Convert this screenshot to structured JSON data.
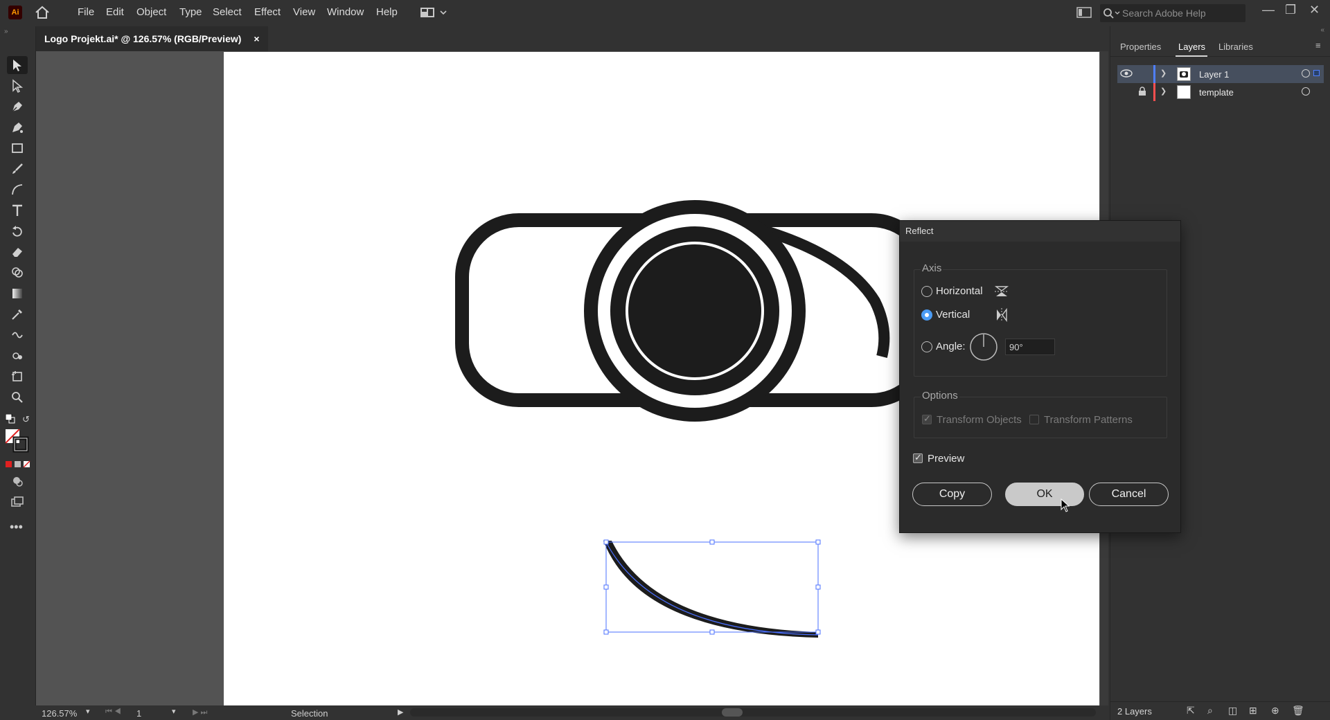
{
  "app": {
    "logo": "Ai",
    "name": "Adobe Illustrator"
  },
  "menu": [
    "File",
    "Edit",
    "Object",
    "Type",
    "Select",
    "Effect",
    "View",
    "Window",
    "Help"
  ],
  "search": {
    "placeholder": "Search Adobe Help"
  },
  "document_tab": {
    "title": "Logo Projekt.ai* @ 126.57% (RGB/Preview)",
    "close": "×"
  },
  "tools": [
    "selection-tool",
    "direct-selection-tool",
    "pen-tool",
    "curvature-tool",
    "rectangle-tool",
    "paintbrush-tool",
    "arc-tool",
    "type-tool",
    "rotate-tool",
    "eraser-tool",
    "shape-builder-tool",
    "gradient-tool",
    "eyedropper-tool",
    "blend-tool",
    "symbol-sprayer-tool",
    "artboard-tool",
    "zoom-tool"
  ],
  "right_panel": {
    "tabs": [
      "Properties",
      "Layers",
      "Libraries"
    ],
    "active_tab": "Layers",
    "layers": [
      {
        "name": "Layer 1",
        "visible": true,
        "locked": false,
        "color": "#4f7fff",
        "selected": true
      },
      {
        "name": "template",
        "visible": false,
        "locked": true,
        "color": "#ff4f4f",
        "selected": false
      }
    ],
    "layer_count": "2 Layers"
  },
  "status": {
    "zoom": "126.57%",
    "artboard": "1",
    "tool": "Selection"
  },
  "reflect_dialog": {
    "title": "Reflect",
    "axis_legend": "Axis",
    "horizontal_label": "Horizontal",
    "vertical_label": "Vertical",
    "angle_label": "Angle:",
    "angle_value": "90°",
    "selected_axis": "Vertical",
    "options_legend": "Options",
    "transform_objects_label": "Transform Objects",
    "transform_patterns_label": "Transform Patterns",
    "transform_objects_checked": true,
    "transform_patterns_checked": false,
    "preview_label": "Preview",
    "preview_checked": true,
    "copy_label": "Copy",
    "ok_label": "OK",
    "cancel_label": "Cancel"
  }
}
